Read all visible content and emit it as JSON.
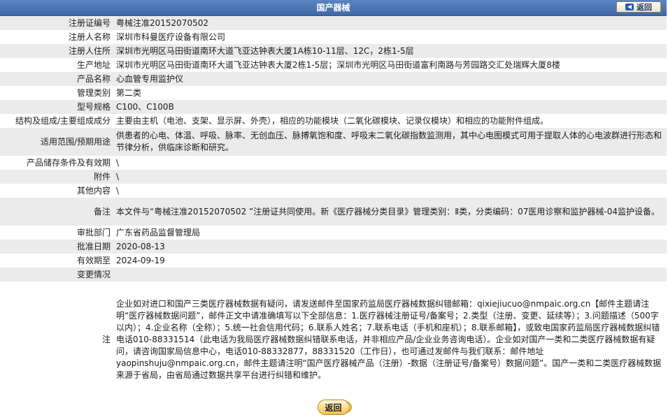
{
  "header": {
    "title": "国产器械",
    "back_label": "返回"
  },
  "rows": [
    {
      "key": "注册证编号",
      "value": "粤械注准20152070502"
    },
    {
      "key": "注册人名称",
      "value": "深圳市科曼医疗设备有限公司"
    },
    {
      "key": "注册人住所",
      "value": "深圳市光明区马田街道南环大道飞亚达钟表大厦1A栋10-11层、12C，2栋1-5层"
    },
    {
      "key": "生产地址",
      "value": "深圳市光明区马田街道南环大道飞亚达钟表大厦2栋1-5层；深圳市光明区马田街道富利南路与芳园路交汇处瑞辉大厦8楼"
    },
    {
      "key": "产品名称",
      "value": "心血管专用监护仪"
    },
    {
      "key": "管理类别",
      "value": "第二类"
    },
    {
      "key": "型号规格",
      "value": "C100、C100B"
    },
    {
      "key": "结构及组成/主要组成成分",
      "value": "主要由主机（电池、支架、显示屏、外壳），相应的功能模块（二氧化碳模块、记录仪模块）和相应的功能附件组成。"
    },
    {
      "key": "适用范围/预期用途",
      "value": "供患者的心电、体温、呼吸、脉率、无创血压、脉搏氧饱和度、呼吸末二氧化碳指数监测用，其中心电图模式可用于提取人体的心电波群进行形态和节律分析，供临床诊断和研究。"
    },
    {
      "key": "产品储存条件及有效期",
      "value": "\\"
    },
    {
      "key": "附件",
      "value": "\\"
    },
    {
      "key": "其他内容",
      "value": "\\"
    },
    {
      "key": "备注",
      "value": "本文件与“粤械注准20152070502 ”注册证共同使用。新《医疗器械分类目录》管理类别：Ⅱ类，分类编码：07医用诊察和监护器械-04监护设备。"
    },
    {
      "key": "审批部门",
      "value": "广东省药品监督管理局"
    },
    {
      "key": "批准日期",
      "value": "2020-08-13"
    },
    {
      "key": "有效期至",
      "value": "2024-09-19"
    },
    {
      "key": "变更情况",
      "value": ""
    }
  ],
  "note": {
    "key": "注",
    "value": "企业如对进口和国产三类医疗器械数据有疑问，请发送邮件至国家药监局医疗器械数据纠错邮箱：qixiejiucuo@nmpaic.org.cn【邮件主题请注明“医疗器械数据问题”，邮件正文中请准确填写以下全部信息：1.医疗器械注册证号/备案号；2.类型（注册、变更、延续等）；3.问题描述（500字以内）；4.企业名称（全称）；5.统一社会信用代码；6.联系人姓名；7.联系电话（手机和座机）；8.联系邮箱】，或致电国家药监局医疗器械数据纠错电话010-88331514（此电话为我局医疗器械数据纠错联系电话，并非相应产品/企业业务咨询电话）。企业如对国产一类和二类医疗器械数据有疑问，请咨询国家局信息中心，电话010-88332877，88331520（工作日），也可通过发邮件与我们联系：邮件地址yaopinshuju@nmpaic.org.cn，邮件主题请注明“国产医疗器械产品（注册）-数据（注册证号/备案号）数据问题”。国产一类和二类医疗器械数据来源于省局，由省局通过数据共享平台进行纠错和维护。"
  },
  "footer": {
    "back_label": "返回"
  }
}
